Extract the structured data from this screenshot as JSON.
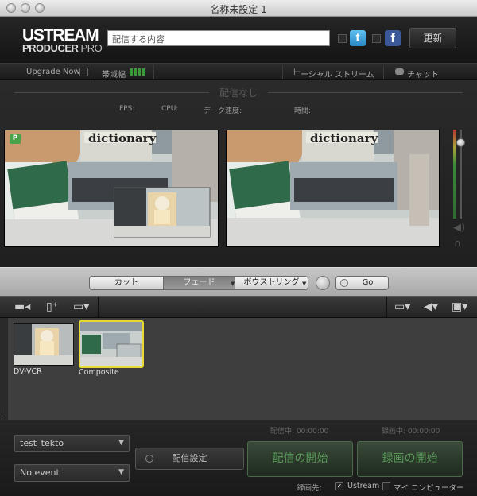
{
  "window": {
    "title": "名称未設定 1"
  },
  "header": {
    "logo_line1": "USTREAM",
    "logo_line2a": "PRODUCER",
    "logo_line2b": " PRO",
    "status_placeholder": "配信する内容",
    "twitter_glyph": "t",
    "facebook_glyph": "f",
    "update_button": "更新"
  },
  "strip": {
    "upgrade": "Upgrade Now",
    "bandwidth": "帯域幅",
    "social_stream": "ーシャル ストリーム",
    "chat": "チャット"
  },
  "stats": {
    "no_stream": "配信なし",
    "fps": "FPS:",
    "cpu": "CPU:",
    "data_rate": "データ速度:",
    "time": "時間:"
  },
  "preview": {
    "badge": "P",
    "sign": "dictionary"
  },
  "transitions": {
    "cut": "カット",
    "fade": "フェード",
    "bounce": "ボウストリング",
    "go": "Go"
  },
  "sources": [
    {
      "label": "DV-VCR"
    },
    {
      "label": "Composite"
    }
  ],
  "bottom": {
    "account": "test_tekto",
    "event": "No event",
    "config_button": "配信設定",
    "stream_time": "配信中: 00:00:00",
    "record_time": "録画中: 00:00:00",
    "start_stream": "配信の開始",
    "start_record": "録画の開始",
    "record_dest_label": "録画先:",
    "dest_ustream": "Ustream",
    "dest_computer": "マイ コンピューター"
  },
  "colors": {
    "accent_green": "#5a9a5a",
    "twitter": "#3f9fd6",
    "facebook": "#3b5998"
  }
}
